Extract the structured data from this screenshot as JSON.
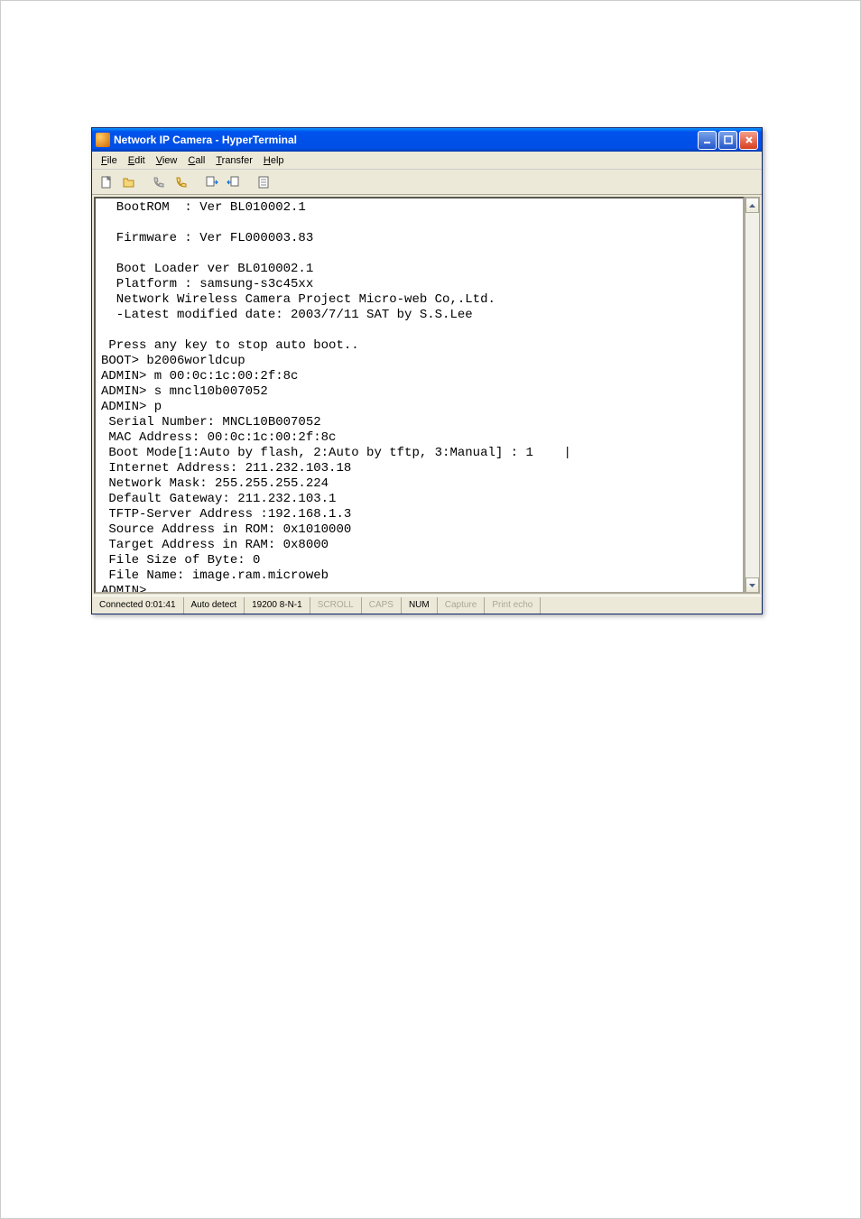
{
  "window": {
    "title": "Network IP Camera - HyperTerminal"
  },
  "menubar": {
    "items": [
      {
        "label": "File",
        "ukey": "F"
      },
      {
        "label": "Edit",
        "ukey": "E"
      },
      {
        "label": "View",
        "ukey": "V"
      },
      {
        "label": "Call",
        "ukey": "C"
      },
      {
        "label": "Transfer",
        "ukey": "T"
      },
      {
        "label": "Help",
        "ukey": "H"
      }
    ]
  },
  "terminal": {
    "lines": [
      "  BootROM  : Ver BL010002.1",
      "",
      "  Firmware : Ver FL000003.83",
      "",
      "  Boot Loader ver BL010002.1",
      "  Platform : samsung-s3c45xx",
      "  Network Wireless Camera Project Micro-web Co,.Ltd.",
      "  -Latest modified date: 2003/7/11 SAT by S.S.Lee",
      "",
      " Press any key to stop auto boot..",
      "BOOT> b2006worldcup",
      "ADMIN> m 00:0c:1c:00:2f:8c",
      "ADMIN> s mncl10b007052",
      "ADMIN> p",
      " Serial Number: MNCL10B007052",
      " MAC Address: 00:0c:1c:00:2f:8c",
      " Boot Mode[1:Auto by flash, 2:Auto by tftp, 3:Manual] : 1    |",
      " Internet Address: 211.232.103.18",
      " Network Mask: 255.255.255.224",
      " Default Gateway: 211.232.103.1",
      " TFTP-Server Address :192.168.1.3",
      " Source Address in ROM: 0x1010000",
      " Target Address in RAM: 0x8000",
      " File Size of Byte: 0",
      " File Name: image.ram.microweb",
      "ADMIN>"
    ]
  },
  "statusbar": {
    "connected": "Connected 0:01:41",
    "detect": "Auto detect",
    "baud": "19200 8-N-1",
    "scroll": "SCROLL",
    "caps": "CAPS",
    "num": "NUM",
    "capture": "Capture",
    "printecho": "Print echo"
  }
}
